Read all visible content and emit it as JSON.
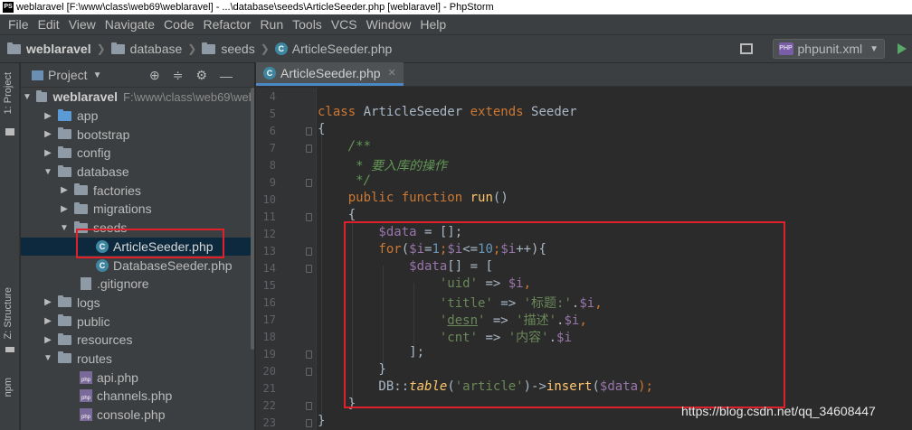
{
  "window": {
    "title": "weblaravel [F:\\www\\class\\web69\\weblaravel] - ...\\database\\seeds\\ArticleSeeder.php [weblaravel] - PhpStorm",
    "app_icon": "PS"
  },
  "menu": [
    "File",
    "Edit",
    "View",
    "Navigate",
    "Code",
    "Refactor",
    "Run",
    "Tools",
    "VCS",
    "Window",
    "Help"
  ],
  "breadcrumb": [
    "weblaravel",
    "database",
    "seeds",
    "ArticleSeeder.php"
  ],
  "run_config": {
    "label": "phpunit.xml",
    "icon": "phpunit-icon",
    "badge": "PHP"
  },
  "toolstrip": {
    "project": "1: Project",
    "structure": "Z: Structure",
    "npm": "npm"
  },
  "project_panel": {
    "title": "Project",
    "tree": [
      {
        "label": "weblaravel",
        "path": "F:\\www\\class\\web69\\web",
        "kind": "folder",
        "expanded": true
      },
      {
        "label": "app",
        "kind": "folder",
        "expanded": false
      },
      {
        "label": "bootstrap",
        "kind": "folder",
        "expanded": false
      },
      {
        "label": "config",
        "kind": "folder",
        "expanded": false
      },
      {
        "label": "database",
        "kind": "folder",
        "expanded": true
      },
      {
        "label": "factories",
        "kind": "folder",
        "expanded": false
      },
      {
        "label": "migrations",
        "kind": "folder",
        "expanded": false
      },
      {
        "label": "seeds",
        "kind": "folder",
        "expanded": true
      },
      {
        "label": "ArticleSeeder.php",
        "kind": "class",
        "selected": true
      },
      {
        "label": "DatabaseSeeder.php",
        "kind": "class"
      },
      {
        "label": ".gitignore",
        "kind": "file"
      },
      {
        "label": "logs",
        "kind": "folder",
        "expanded": false
      },
      {
        "label": "public",
        "kind": "folder",
        "expanded": false
      },
      {
        "label": "resources",
        "kind": "folder",
        "expanded": false
      },
      {
        "label": "routes",
        "kind": "folder",
        "expanded": true
      },
      {
        "label": "api.php",
        "kind": "php"
      },
      {
        "label": "channels.php",
        "kind": "php"
      },
      {
        "label": "console.php",
        "kind": "php"
      }
    ]
  },
  "editor": {
    "tab": "ArticleSeeder.php",
    "line_numbers": [
      "4",
      "5",
      "6",
      "7",
      "8",
      "9",
      "10",
      "11",
      "12",
      "13",
      "14",
      "15",
      "16",
      "17",
      "18",
      "19",
      "20",
      "21",
      "22",
      "23"
    ]
  },
  "code": {
    "l5_class": "class",
    "l5_name": " ArticleSeeder ",
    "l5_extends": "extends",
    "l5_parent": " Seeder",
    "l6": "{",
    "l7": "    /**",
    "l8": "     * 要入库的操作",
    "l9": "     */",
    "l10_public": "    public",
    "l10_function": " function ",
    "l10_run": "run",
    "l10_paren": "()",
    "l11": "    {",
    "l12_var": "        $data",
    "l12_rest": " = [];",
    "l13_for": "        for",
    "l13_a": "(",
    "l13_i1": "$i",
    "l13_b": "=",
    "l13_n1": "1",
    "l13_c": ";",
    "l13_i2": "$i",
    "l13_d": "<=",
    "l13_n2": "10",
    "l13_e": ";",
    "l13_i3": "$i",
    "l13_f": "++){",
    "l14_var": "            $data",
    "l14_rest": "[] = [",
    "l15_key": "                'uid'",
    "l15_arrow": " => ",
    "l15_val": "$i",
    "l15_end": ",",
    "l16_key": "                'title'",
    "l16_arrow": " => ",
    "l16_str": "'标题:'",
    "l16_dot": ".",
    "l16_val": "$i",
    "l16_end": ",",
    "l17_pre": "                '",
    "l17_word": "desn",
    "l17_post": "'",
    "l17_arrow": " => ",
    "l17_str": "'描述'",
    "l17_dot": ".",
    "l17_val": "$i",
    "l17_end": ",",
    "l18_key": "                'cnt'",
    "l18_arrow": " => ",
    "l18_str": "'内容'",
    "l18_dot": ".",
    "l18_val": "$i",
    "l19": "            ];",
    "l20": "        }",
    "l21_db": "        DB::",
    "l21_table": "table",
    "l21_a": "(",
    "l21_str": "'article'",
    "l21_b": ")->",
    "l21_insert": "insert",
    "l21_c": "(",
    "l21_var": "$data",
    "l21_d": ");",
    "l22": "    }",
    "l23": "}"
  },
  "watermark": "https://blog.csdn.net/qq_34608447",
  "highlight_color": "#e0202a"
}
